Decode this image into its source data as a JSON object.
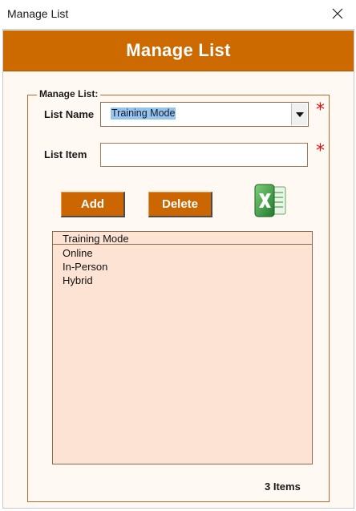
{
  "window": {
    "title": "Manage List",
    "close_icon": "close-icon"
  },
  "header": {
    "title": "Manage List",
    "background": "#cc6a00"
  },
  "form": {
    "group_label": "Manage List:",
    "list_name_label": "List Name",
    "list_name_value": "Training Mode",
    "list_item_label": "List Item",
    "list_item_value": "",
    "required_marker": "*",
    "required_color": "#e01010"
  },
  "buttons": {
    "add_label": "Add",
    "delete_label": "Delete",
    "export_icon": "excel-icon"
  },
  "list": {
    "header": "Training Mode",
    "items": [
      "Online",
      "In-Person",
      "Hybrid"
    ],
    "background": "#fde3d4"
  },
  "status": {
    "count_text": "3 Items"
  }
}
